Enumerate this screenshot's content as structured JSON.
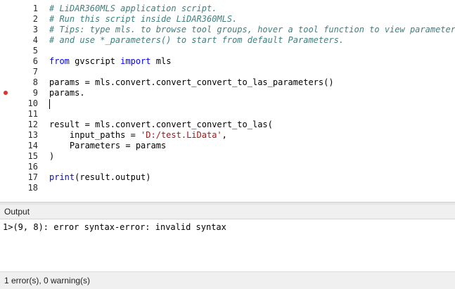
{
  "editor": {
    "lines": [
      {
        "num": "1",
        "tokens": [
          {
            "t": "comment",
            "v": "# LiDAR360MLS application script."
          }
        ]
      },
      {
        "num": "2",
        "tokens": [
          {
            "t": "comment",
            "v": "# Run this script inside LiDAR360MLS."
          }
        ]
      },
      {
        "num": "3",
        "tokens": [
          {
            "t": "comment",
            "v": "# Tips: type mls. to browse tool groups, hover a tool function to view parameters,"
          }
        ]
      },
      {
        "num": "4",
        "tokens": [
          {
            "t": "comment",
            "v": "# and use *_parameters() to start from default Parameters."
          }
        ]
      },
      {
        "num": "5",
        "tokens": []
      },
      {
        "num": "6",
        "tokens": [
          {
            "t": "keyword",
            "v": "from"
          },
          {
            "t": "plain",
            "v": " gvscript "
          },
          {
            "t": "keyword",
            "v": "import"
          },
          {
            "t": "plain",
            "v": " mls"
          }
        ]
      },
      {
        "num": "7",
        "tokens": []
      },
      {
        "num": "8",
        "tokens": [
          {
            "t": "plain",
            "v": "params = mls.convert.convert_convert_to_las_parameters()"
          }
        ]
      },
      {
        "num": "9",
        "tokens": [
          {
            "t": "plain",
            "v": "params."
          }
        ]
      },
      {
        "num": "10",
        "tokens": []
      },
      {
        "num": "11",
        "tokens": []
      },
      {
        "num": "12",
        "tokens": [
          {
            "t": "plain",
            "v": "result = mls.convert.convert_convert_to_las("
          }
        ]
      },
      {
        "num": "13",
        "tokens": [
          {
            "t": "plain",
            "v": "    input_paths = "
          },
          {
            "t": "string",
            "v": "'D:/test.LiData'"
          },
          {
            "t": "plain",
            "v": ","
          }
        ]
      },
      {
        "num": "14",
        "tokens": [
          {
            "t": "plain",
            "v": "    Parameters = params"
          }
        ]
      },
      {
        "num": "15",
        "tokens": [
          {
            "t": "plain",
            "v": ")"
          }
        ]
      },
      {
        "num": "16",
        "tokens": []
      },
      {
        "num": "17",
        "tokens": [
          {
            "t": "keyword",
            "v": "print"
          },
          {
            "t": "plain",
            "v": "(result.output)"
          }
        ]
      },
      {
        "num": "18",
        "tokens": []
      }
    ],
    "current_line": 10,
    "error_line": 9
  },
  "output": {
    "title": "Output",
    "messages": [
      "1>(9, 8): error syntax-error: invalid syntax"
    ]
  },
  "status": {
    "summary": "1 error(s), 0 warning(s)"
  },
  "colors": {
    "comment": "#3f7f7f",
    "keyword": "#0000ff",
    "string": "#a31515",
    "error_marker": "#e0322e"
  }
}
